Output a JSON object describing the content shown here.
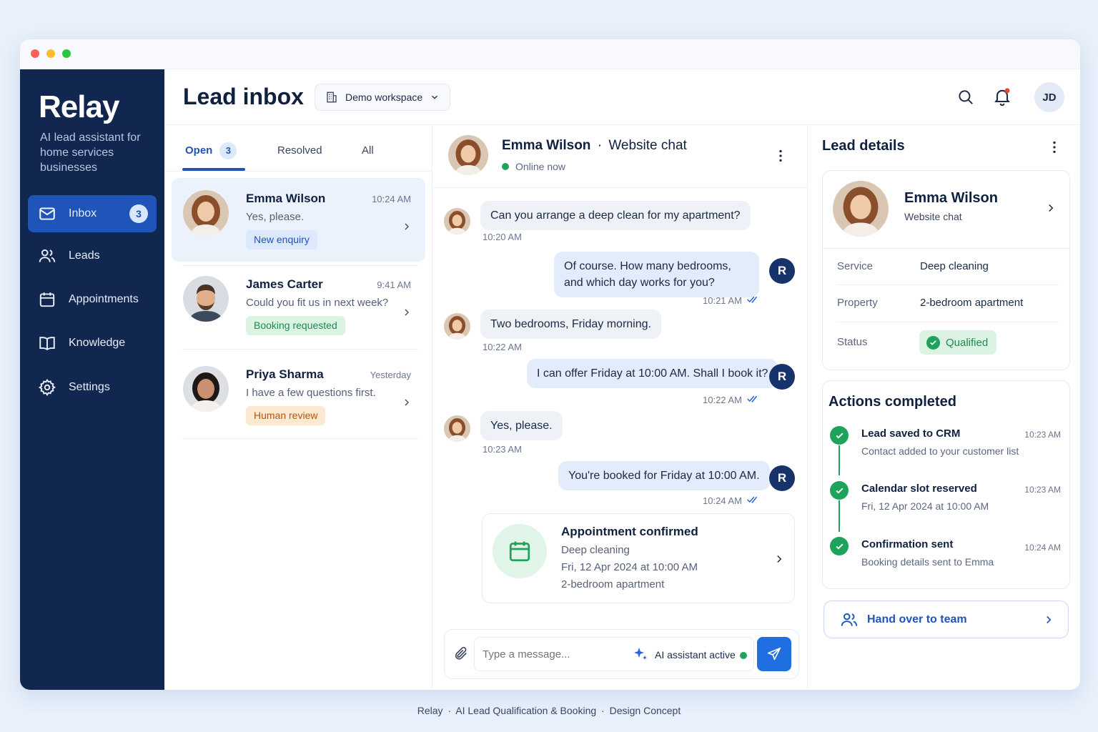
{
  "window_controls": {
    "colors": [
      "#ff5f57",
      "#febc2e",
      "#28c840"
    ]
  },
  "sidebar": {
    "brand": "Relay",
    "tagline": "AI lead assistant for home services businesses",
    "items": [
      {
        "label": "Inbox",
        "icon": "mail-icon",
        "badge": "3",
        "active": true
      },
      {
        "label": "Leads",
        "icon": "users-icon"
      },
      {
        "label": "Appointments",
        "icon": "calendar-icon"
      },
      {
        "label": "Knowledge",
        "icon": "book-icon"
      },
      {
        "label": "Settings",
        "icon": "gear-icon"
      }
    ]
  },
  "header": {
    "title": "Lead inbox",
    "workspace": "Demo workspace",
    "user_initials": "JD",
    "notification_dot_color": "#e8472f"
  },
  "tabs": [
    {
      "label": "Open",
      "count": "3",
      "active": true
    },
    {
      "label": "Resolved"
    },
    {
      "label": "All"
    }
  ],
  "conversations": [
    {
      "name": "Emma Wilson",
      "time": "10:24 AM",
      "preview": "Yes, please.",
      "tag": "New enquiry",
      "selected": true
    },
    {
      "name": "James Carter",
      "time": "9:41 AM",
      "preview": "Could you fit us in next week?",
      "tag": "Booking requested"
    },
    {
      "name": "Priya Sharma",
      "time": "Yesterday",
      "preview": "I have a few questions first.",
      "tag": "Human review"
    }
  ],
  "chat": {
    "contact": "Emma Wilson",
    "separator": "·",
    "channel": "Website chat",
    "status": "Online now",
    "agent_initial": "R",
    "messages": [
      {
        "dir": "in",
        "text": "Can you arrange a deep clean for my apartment?",
        "time": "10:20 AM"
      },
      {
        "dir": "out",
        "text": "Of course. How many bedrooms, and which day works for you?",
        "time": "10:21 AM"
      },
      {
        "dir": "in",
        "text": "Two bedrooms, Friday morning.",
        "time": "10:22 AM"
      },
      {
        "dir": "out",
        "text": "I can offer Friday at 10:00 AM. Shall I book it?",
        "time": "10:22 AM"
      },
      {
        "dir": "in",
        "text": "Yes, please.",
        "time": "10:23 AM"
      },
      {
        "dir": "out",
        "text": "You're booked for Friday at 10:00 AM.",
        "time": "10:24 AM"
      }
    ],
    "appointment": {
      "title": "Appointment confirmed",
      "service": "Deep cleaning",
      "when": "Fri, 12 Apr 2024 at 10:00 AM",
      "property": "2-bedroom apartment"
    },
    "composer": {
      "placeholder": "Type a message...",
      "assistant": "AI assistant active"
    }
  },
  "details": {
    "title": "Lead details",
    "name": "Emma Wilson",
    "channel": "Website chat",
    "fields": [
      {
        "label": "Service",
        "value": "Deep cleaning"
      },
      {
        "label": "Property",
        "value": "2-bedroom apartment"
      },
      {
        "label": "Status",
        "value": "Qualified"
      }
    ],
    "actions_title": "Actions completed",
    "actions": [
      {
        "title": "Lead saved to CRM",
        "sub": "Contact added to your customer list",
        "time": "10:23 AM"
      },
      {
        "title": "Calendar slot reserved",
        "sub": "Fri, 12 Apr 2024 at 10:00 AM",
        "time": "10:23 AM"
      },
      {
        "title": "Confirmation sent",
        "sub": "Booking details sent to Emma",
        "time": "10:24 AM"
      }
    ],
    "handover": "Hand over to team"
  },
  "footer": {
    "parts": [
      "Relay",
      "AI Lead Qualification & Booking",
      "Design Concept"
    ],
    "separator": "·"
  }
}
